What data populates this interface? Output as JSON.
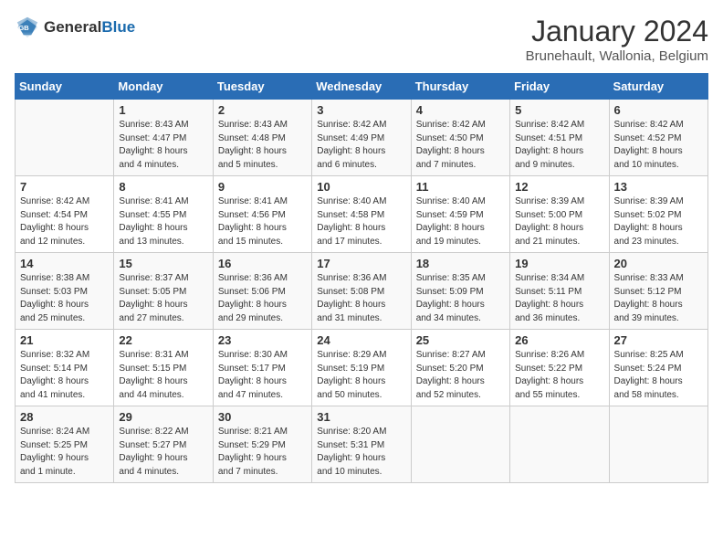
{
  "header": {
    "logo_general": "General",
    "logo_blue": "Blue",
    "month_title": "January 2024",
    "subtitle": "Brunehault, Wallonia, Belgium"
  },
  "days_of_week": [
    "Sunday",
    "Monday",
    "Tuesday",
    "Wednesday",
    "Thursday",
    "Friday",
    "Saturday"
  ],
  "weeks": [
    [
      {
        "day": "",
        "info": ""
      },
      {
        "day": "1",
        "info": "Sunrise: 8:43 AM\nSunset: 4:47 PM\nDaylight: 8 hours\nand 4 minutes."
      },
      {
        "day": "2",
        "info": "Sunrise: 8:43 AM\nSunset: 4:48 PM\nDaylight: 8 hours\nand 5 minutes."
      },
      {
        "day": "3",
        "info": "Sunrise: 8:42 AM\nSunset: 4:49 PM\nDaylight: 8 hours\nand 6 minutes."
      },
      {
        "day": "4",
        "info": "Sunrise: 8:42 AM\nSunset: 4:50 PM\nDaylight: 8 hours\nand 7 minutes."
      },
      {
        "day": "5",
        "info": "Sunrise: 8:42 AM\nSunset: 4:51 PM\nDaylight: 8 hours\nand 9 minutes."
      },
      {
        "day": "6",
        "info": "Sunrise: 8:42 AM\nSunset: 4:52 PM\nDaylight: 8 hours\nand 10 minutes."
      }
    ],
    [
      {
        "day": "7",
        "info": "Sunrise: 8:42 AM\nSunset: 4:54 PM\nDaylight: 8 hours\nand 12 minutes."
      },
      {
        "day": "8",
        "info": "Sunrise: 8:41 AM\nSunset: 4:55 PM\nDaylight: 8 hours\nand 13 minutes."
      },
      {
        "day": "9",
        "info": "Sunrise: 8:41 AM\nSunset: 4:56 PM\nDaylight: 8 hours\nand 15 minutes."
      },
      {
        "day": "10",
        "info": "Sunrise: 8:40 AM\nSunset: 4:58 PM\nDaylight: 8 hours\nand 17 minutes."
      },
      {
        "day": "11",
        "info": "Sunrise: 8:40 AM\nSunset: 4:59 PM\nDaylight: 8 hours\nand 19 minutes."
      },
      {
        "day": "12",
        "info": "Sunrise: 8:39 AM\nSunset: 5:00 PM\nDaylight: 8 hours\nand 21 minutes."
      },
      {
        "day": "13",
        "info": "Sunrise: 8:39 AM\nSunset: 5:02 PM\nDaylight: 8 hours\nand 23 minutes."
      }
    ],
    [
      {
        "day": "14",
        "info": "Sunrise: 8:38 AM\nSunset: 5:03 PM\nDaylight: 8 hours\nand 25 minutes."
      },
      {
        "day": "15",
        "info": "Sunrise: 8:37 AM\nSunset: 5:05 PM\nDaylight: 8 hours\nand 27 minutes."
      },
      {
        "day": "16",
        "info": "Sunrise: 8:36 AM\nSunset: 5:06 PM\nDaylight: 8 hours\nand 29 minutes."
      },
      {
        "day": "17",
        "info": "Sunrise: 8:36 AM\nSunset: 5:08 PM\nDaylight: 8 hours\nand 31 minutes."
      },
      {
        "day": "18",
        "info": "Sunrise: 8:35 AM\nSunset: 5:09 PM\nDaylight: 8 hours\nand 34 minutes."
      },
      {
        "day": "19",
        "info": "Sunrise: 8:34 AM\nSunset: 5:11 PM\nDaylight: 8 hours\nand 36 minutes."
      },
      {
        "day": "20",
        "info": "Sunrise: 8:33 AM\nSunset: 5:12 PM\nDaylight: 8 hours\nand 39 minutes."
      }
    ],
    [
      {
        "day": "21",
        "info": "Sunrise: 8:32 AM\nSunset: 5:14 PM\nDaylight: 8 hours\nand 41 minutes."
      },
      {
        "day": "22",
        "info": "Sunrise: 8:31 AM\nSunset: 5:15 PM\nDaylight: 8 hours\nand 44 minutes."
      },
      {
        "day": "23",
        "info": "Sunrise: 8:30 AM\nSunset: 5:17 PM\nDaylight: 8 hours\nand 47 minutes."
      },
      {
        "day": "24",
        "info": "Sunrise: 8:29 AM\nSunset: 5:19 PM\nDaylight: 8 hours\nand 50 minutes."
      },
      {
        "day": "25",
        "info": "Sunrise: 8:27 AM\nSunset: 5:20 PM\nDaylight: 8 hours\nand 52 minutes."
      },
      {
        "day": "26",
        "info": "Sunrise: 8:26 AM\nSunset: 5:22 PM\nDaylight: 8 hours\nand 55 minutes."
      },
      {
        "day": "27",
        "info": "Sunrise: 8:25 AM\nSunset: 5:24 PM\nDaylight: 8 hours\nand 58 minutes."
      }
    ],
    [
      {
        "day": "28",
        "info": "Sunrise: 8:24 AM\nSunset: 5:25 PM\nDaylight: 9 hours\nand 1 minute."
      },
      {
        "day": "29",
        "info": "Sunrise: 8:22 AM\nSunset: 5:27 PM\nDaylight: 9 hours\nand 4 minutes."
      },
      {
        "day": "30",
        "info": "Sunrise: 8:21 AM\nSunset: 5:29 PM\nDaylight: 9 hours\nand 7 minutes."
      },
      {
        "day": "31",
        "info": "Sunrise: 8:20 AM\nSunset: 5:31 PM\nDaylight: 9 hours\nand 10 minutes."
      },
      {
        "day": "",
        "info": ""
      },
      {
        "day": "",
        "info": ""
      },
      {
        "day": "",
        "info": ""
      }
    ]
  ]
}
